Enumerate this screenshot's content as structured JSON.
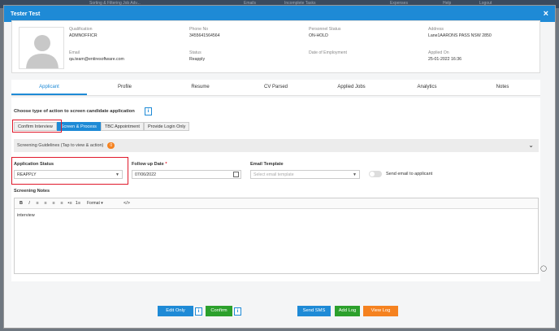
{
  "background": {
    "items": [
      "Sorting & Filtering Job Adv...",
      "Emails",
      "Incomplete Tasks",
      "Expenses",
      "Help",
      "Logout"
    ]
  },
  "modal": {
    "title": "Tester Test",
    "close": "×"
  },
  "profile": {
    "qualification": {
      "label": "Qualification",
      "value": "ADMNOFFICR"
    },
    "phone": {
      "label": "Phone No",
      "value": "3455641564564"
    },
    "personnel_status": {
      "label": "Personnel Status",
      "value": "ON-HOLD"
    },
    "address": {
      "label": "Address",
      "value": "Lane1AARONS PASS NSW 2850"
    },
    "email": {
      "label": "Email",
      "value": "qa.team@entiresoftware.com"
    },
    "status": {
      "label": "Status",
      "value": "Reapply"
    },
    "employment": {
      "label": "Date of Employment",
      "value": ""
    },
    "applied": {
      "label": "Applied On",
      "value": "25-01-2022 16:36"
    }
  },
  "tabs": [
    "Applicant",
    "Profile",
    "Resume",
    "CV Parsed",
    "Applied Jobs",
    "Analytics",
    "Notes"
  ],
  "active_tab": "Applicant",
  "screen": {
    "choose_label": "Choose type of action to screen candidate application",
    "info_icon": "i",
    "actions": [
      "Confirm Interview",
      "Screen & Process",
      "TBC Appointment",
      "Provide Login Only"
    ],
    "active_action": "Screen & Process"
  },
  "guidelines": {
    "label": "Screening Guidelines (Tap to view & action)",
    "badge": "0"
  },
  "form": {
    "app_status_label": "Application Status",
    "app_status_value": "REAPPLY",
    "followup_label": "Follow up Date",
    "required_mark": "*",
    "followup_value": "07/06/2022",
    "email_template_label": "Email Template",
    "email_template_placeholder": "Select email template",
    "send_email_label": "Send email to applicant"
  },
  "notes": {
    "label": "Screening Notes",
    "toolbar": {
      "bold": "B",
      "italic": "I",
      "format": "Format",
      "code": "</>"
    },
    "text": "interview"
  },
  "footer": {
    "edit_only": "Edit Only",
    "confirm": "Confirm",
    "send_sms": "Send SMS",
    "add_log": "Add Log",
    "view_log": "View Log",
    "info": "i"
  },
  "colors": {
    "primary": "#1e8ad6",
    "green": "#2ca02c",
    "orange": "#f58220",
    "highlight": "#e0192b"
  }
}
